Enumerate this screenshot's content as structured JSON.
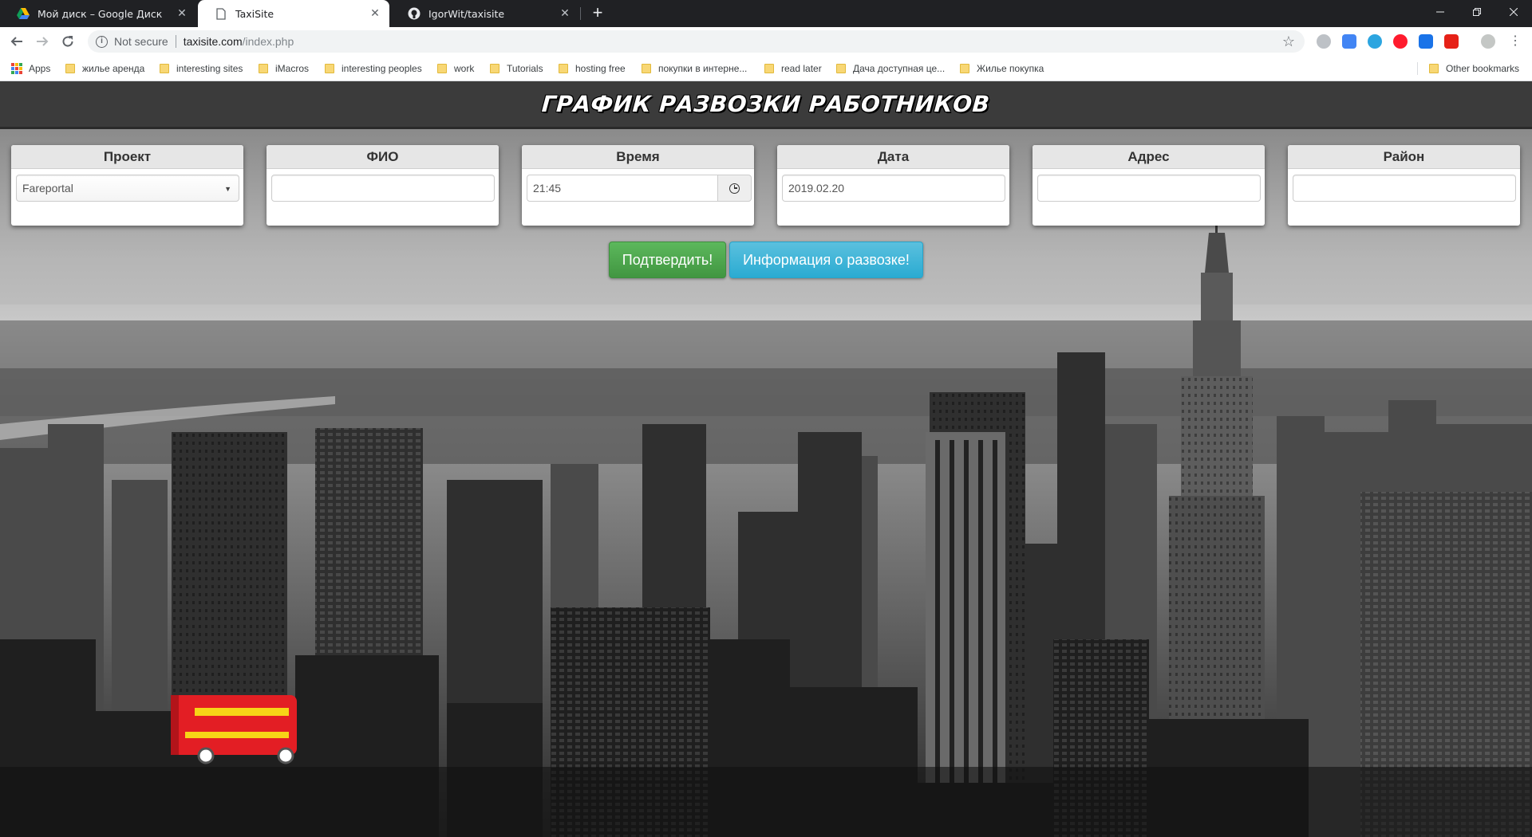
{
  "browser": {
    "tabs": [
      {
        "title": "Мой диск – Google Диск",
        "icon": "google-drive-icon",
        "active": false
      },
      {
        "title": "TaxiSite",
        "icon": "page-icon",
        "active": true
      },
      {
        "title": "IgorWit/taxisite",
        "icon": "github-icon",
        "active": false
      }
    ],
    "address": {
      "security": "Not secure",
      "host": "taxisite.com",
      "path": "/index.php"
    },
    "bookmarks": [
      {
        "label": "Apps",
        "icon": "apps-grid-icon"
      },
      {
        "label": "жилье аренда",
        "icon": "folder-icon"
      },
      {
        "label": "interesting sites",
        "icon": "folder-icon"
      },
      {
        "label": "iMacros",
        "icon": "folder-icon"
      },
      {
        "label": "interesting peoples",
        "icon": "folder-icon"
      },
      {
        "label": "work",
        "icon": "folder-icon"
      },
      {
        "label": "Tutorials",
        "icon": "folder-icon"
      },
      {
        "label": "hosting free",
        "icon": "folder-icon"
      },
      {
        "label": "покупки в интерне...",
        "icon": "folder-icon"
      },
      {
        "label": "read later",
        "icon": "folder-icon"
      },
      {
        "label": "Дача доступная це...",
        "icon": "folder-icon"
      },
      {
        "label": "Жилье покупка",
        "icon": "folder-icon"
      },
      {
        "label": "Other bookmarks",
        "icon": "folder-icon"
      }
    ]
  },
  "page": {
    "header_title": "ГРАФИК РАЗВОЗКИ РАБОТНИКОВ",
    "fields": {
      "project": {
        "label": "Проект",
        "value": "Fareportal"
      },
      "fio": {
        "label": "ФИО",
        "value": ""
      },
      "time": {
        "label": "Время",
        "value": "21:45",
        "icon": "clock-icon"
      },
      "date": {
        "label": "Дата",
        "value": "2019.02.20"
      },
      "address": {
        "label": "Адрес",
        "value": ""
      },
      "district": {
        "label": "Район",
        "value": ""
      }
    },
    "buttons": {
      "confirm": "Подтвердить!",
      "info": "Информация о развозке!"
    },
    "colors": {
      "confirm": "#5cb85c",
      "info": "#5bc0de",
      "bus": "#e31e24"
    }
  }
}
